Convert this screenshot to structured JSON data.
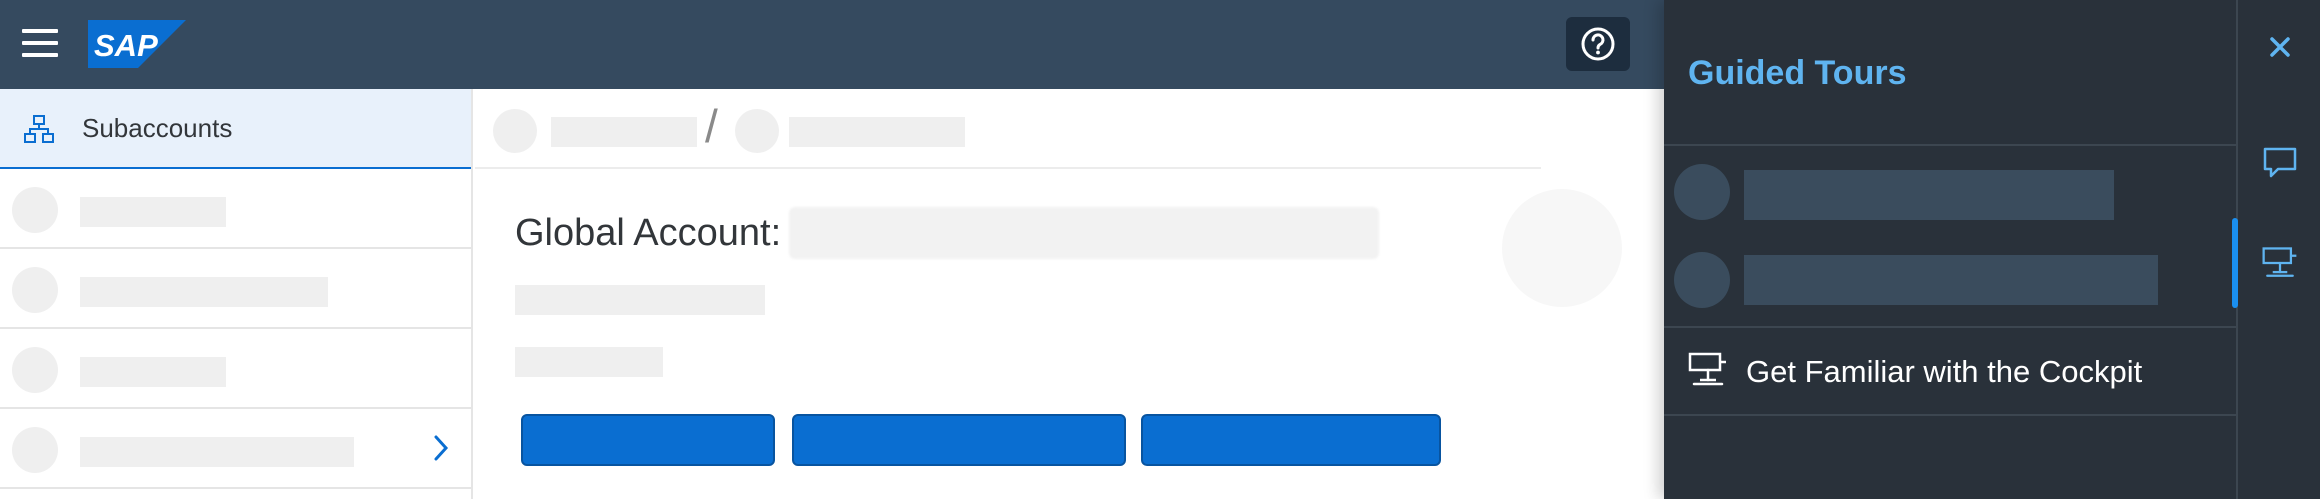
{
  "shell": {
    "logo_text": "SAP",
    "help_icon": "help-circle-icon",
    "colors": {
      "shell_bg": "#354a5f",
      "logo_blue": "#0a6ed1"
    }
  },
  "sidebar": {
    "items": [
      {
        "label": "Subaccounts",
        "icon": "hierarchy-icon",
        "selected": true
      }
    ],
    "more_icon": "chevron-right-icon"
  },
  "main": {
    "breadcrumb_separator": "/",
    "title_label": "Global Account:",
    "colors": {
      "primary_button": "#0a6ed1"
    }
  },
  "guided_tours": {
    "title": "Guided Tours",
    "items": [
      {
        "label": "Get Familiar with the Cockpit",
        "icon": "signpost-icon"
      }
    ],
    "colors": {
      "title": "#5fb4f0",
      "panel_bg": "#29313a"
    }
  },
  "rail": {
    "buttons": [
      {
        "icon": "close-icon"
      },
      {
        "icon": "feedback-icon"
      },
      {
        "icon": "guided-tour-icon",
        "active": true
      }
    ]
  }
}
